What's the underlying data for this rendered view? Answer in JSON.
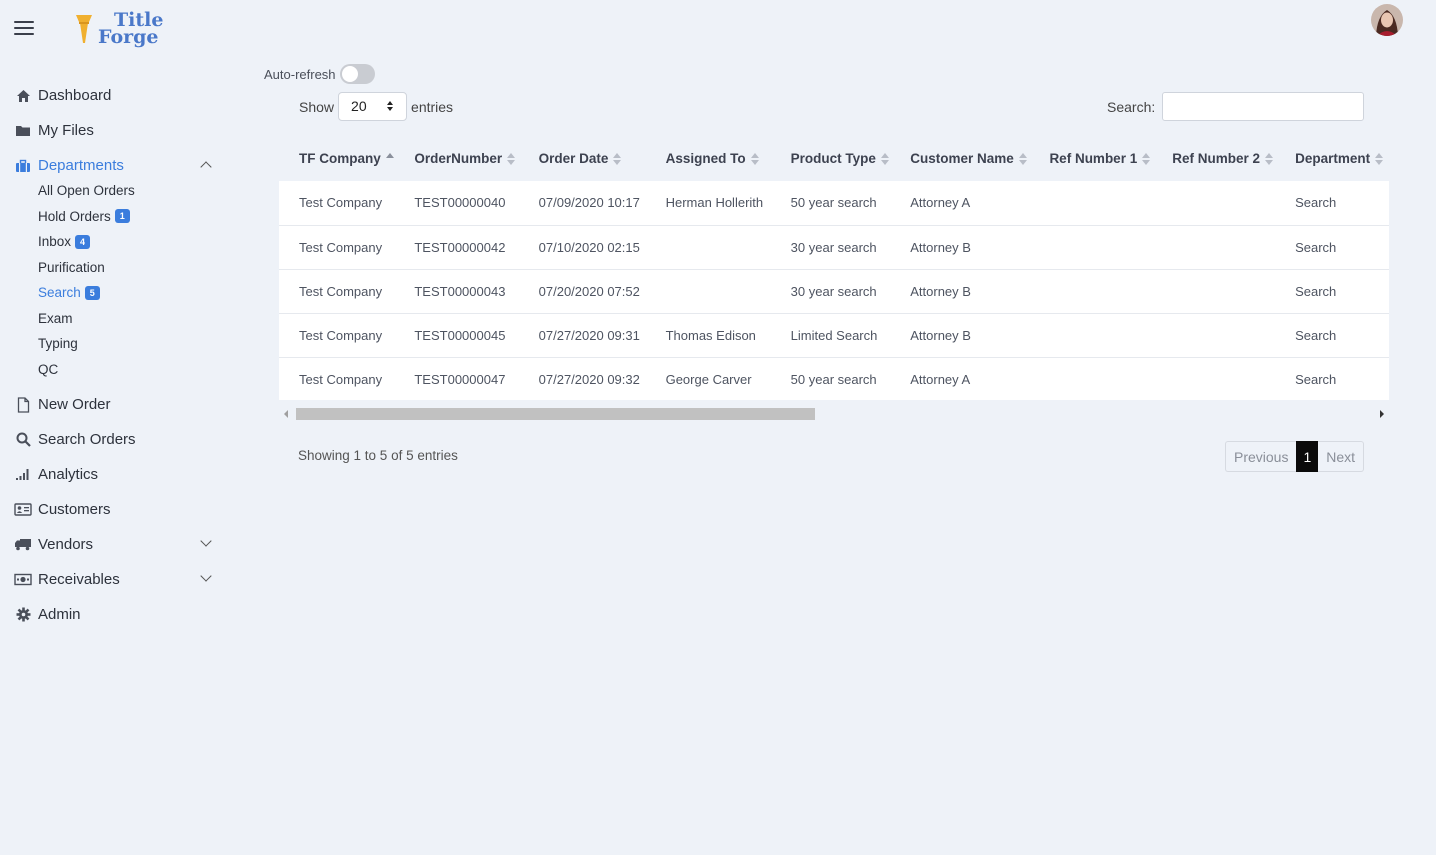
{
  "brand": {
    "line1": "Title",
    "line2": "Forge"
  },
  "sidebar": {
    "items": [
      {
        "label": "Dashboard",
        "icon": "home-icon"
      },
      {
        "label": "My Files",
        "icon": "folder-icon"
      },
      {
        "label": "Departments",
        "icon": "briefcase-icon",
        "active": true,
        "expanded": true
      },
      {
        "label": "New Order",
        "icon": "file-icon"
      },
      {
        "label": "Search Orders",
        "icon": "search-icon"
      },
      {
        "label": "Analytics",
        "icon": "signal-icon"
      },
      {
        "label": "Customers",
        "icon": "id-card-icon"
      },
      {
        "label": "Vendors",
        "icon": "truck-icon",
        "collapsible": true
      },
      {
        "label": "Receivables",
        "icon": "money-bill-icon",
        "collapsible": true
      },
      {
        "label": "Admin",
        "icon": "gear-icon"
      }
    ],
    "departments": [
      {
        "label": "All Open Orders",
        "badge": ""
      },
      {
        "label": "Hold Orders",
        "badge": "1"
      },
      {
        "label": "Inbox",
        "badge": "4"
      },
      {
        "label": "Purification",
        "badge": ""
      },
      {
        "label": "Search",
        "badge": "5",
        "active": true
      },
      {
        "label": "Exam",
        "badge": ""
      },
      {
        "label": "Typing",
        "badge": ""
      },
      {
        "label": "QC",
        "badge": ""
      }
    ]
  },
  "controls": {
    "autorefresh_label": "Auto-refresh",
    "show_label": "Show",
    "entries_value": "20",
    "entries_label": "entries",
    "search_label": "Search:"
  },
  "table": {
    "columns": [
      "TF Company",
      "OrderNumber",
      "Order Date",
      "Assigned To",
      "Product Type",
      "Customer Name",
      "Ref Number 1",
      "Ref Number 2",
      "Department"
    ],
    "rows": [
      [
        "Test Company",
        "TEST00000040",
        "07/09/2020 10:17",
        "Herman Hollerith",
        "50 year search",
        "Attorney A",
        "",
        "",
        "Search"
      ],
      [
        "Test Company",
        "TEST00000042",
        "07/10/2020 02:15",
        "",
        "30 year search",
        "Attorney B",
        "",
        "",
        "Search"
      ],
      [
        "Test Company",
        "TEST00000043",
        "07/20/2020 07:52",
        "",
        "30 year search",
        "Attorney B",
        "",
        "",
        "Search"
      ],
      [
        "Test Company",
        "TEST00000045",
        "07/27/2020 09:31",
        "Thomas Edison",
        "Limited Search",
        "Attorney B",
        "",
        "",
        "Search"
      ],
      [
        "Test Company",
        "TEST00000047",
        "07/27/2020 09:32",
        "George Carver",
        "50 year search",
        "Attorney A",
        "",
        "",
        "Search"
      ]
    ]
  },
  "footer": {
    "info": "Showing 1 to 5 of 5 entries",
    "previous": "Previous",
    "current_page": "1",
    "next": "Next"
  },
  "colors": {
    "accent": "#3b7ddd",
    "logo": "#4a78c9",
    "logo_torch": "#f0b030",
    "background": "#eef2f8"
  }
}
